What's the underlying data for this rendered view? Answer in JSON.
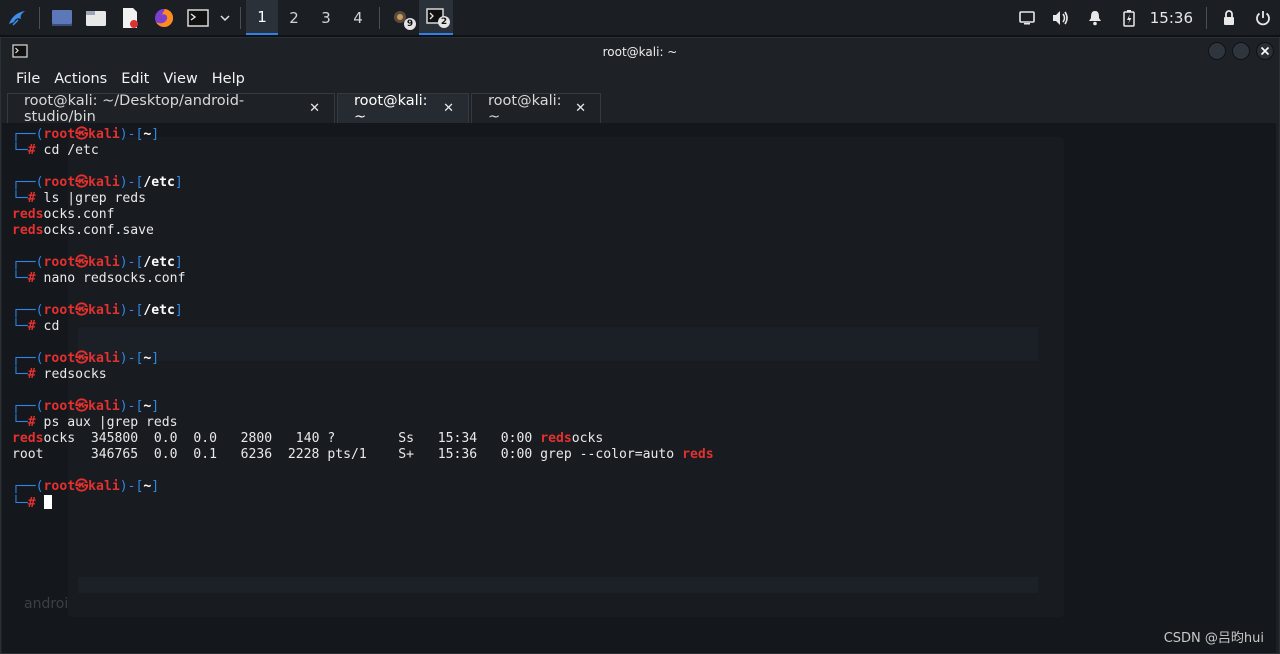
{
  "taskbar": {
    "workspaces": [
      "1",
      "2",
      "3",
      "4"
    ],
    "active_workspace": "1",
    "window_counts": [
      "9",
      "2"
    ],
    "clock": "15:36",
    "icons": [
      "kali-dragon-icon",
      "desktop-icon",
      "file-manager-icon",
      "text-editor-icon",
      "firefox-icon",
      "terminal-icon",
      "chevron-down-icon",
      "display-icon",
      "volume-icon",
      "notifications-icon",
      "battery-icon",
      "lock-icon",
      "power-icon"
    ]
  },
  "window": {
    "title": "root@kali: ~",
    "menu": [
      "File",
      "Actions",
      "Edit",
      "View",
      "Help"
    ],
    "tabs": [
      {
        "label": "root@kali: ~/Desktop/android-studio/bin",
        "close": "✕"
      },
      {
        "label": "root@kali: ~",
        "close": "✕"
      },
      {
        "label": "root@kali: ~",
        "close": "✕"
      }
    ],
    "active_tab": 1
  },
  "terminal": {
    "prompt_parts": {
      "open": "┌──(",
      "user": "root",
      "at": "㉿",
      "host": "kali",
      "mid": ")-[",
      "close": "]",
      "hash_prefix": "└─",
      "hash": "#"
    },
    "blocks": [
      {
        "dir": "~",
        "cmd": "cd /etc",
        "output": []
      },
      {
        "dir": "/etc",
        "cmd": "ls |grep reds",
        "output": [
          {
            "hi": "reds",
            "rest": "ocks.conf"
          },
          {
            "hi": "reds",
            "rest": "ocks.conf.save"
          }
        ]
      },
      {
        "dir": "/etc",
        "cmd": "nano redsocks.conf",
        "output": []
      },
      {
        "dir": "/etc",
        "cmd": "cd",
        "output": []
      },
      {
        "dir": "~",
        "cmd": "redsocks",
        "output": []
      },
      {
        "dir": "~",
        "cmd": "ps aux |grep reds",
        "output": [
          {
            "hi": "reds",
            "rest": "ocks  345800  0.0  0.0   2800   140 ?        Ss   15:34   0:00 ",
            "hi2": "reds",
            "rest2": "ocks"
          },
          {
            "hi": "",
            "rest": "root      346765  0.0  0.1   6236  2228 pts/1    S+   15:36   0:00 grep --color=auto ",
            "hi2": "reds",
            "rest2": ""
          }
        ]
      },
      {
        "dir": "~",
        "cmd": "",
        "output": []
      }
    ]
  },
  "background_window_label": "androi",
  "watermark": "CSDN @吕昀hui",
  "colors": {
    "prompt_blue": "#2f86e6",
    "prompt_red": "#e53030",
    "accent": "#2f81e8"
  }
}
